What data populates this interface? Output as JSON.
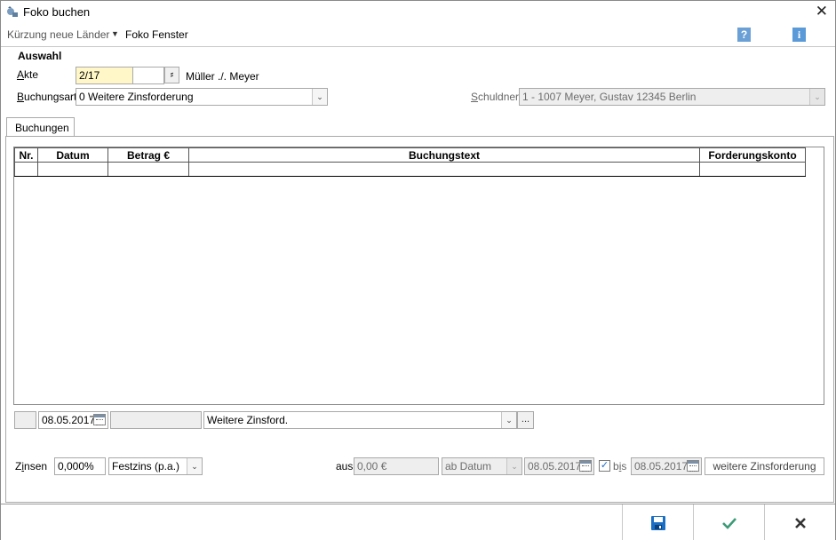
{
  "window": {
    "title": "Foko buchen",
    "close_symbol": "✕"
  },
  "toolbar": {
    "kuerzung_label": "Kürzung neue Länder",
    "foko_label": "Foko Fenster",
    "help_label": "?",
    "info_label": "i"
  },
  "auswahl": {
    "section_title": "Auswahl",
    "akte_label": "Akte",
    "akte_value": "2/17",
    "akte_extra": "",
    "akte_name": "Müller ./. Meyer",
    "buchungsart_label": "Buchungsart",
    "buchungsart_value": "0 Weitere Zinsforderung",
    "schuldner_label": "Schuldner",
    "schuldner_value": "1 - 1007 Meyer, Gustav 12345 Berlin"
  },
  "tabs": [
    {
      "label": "Buchungen"
    }
  ],
  "grid": {
    "columns": [
      "Nr.",
      "Datum",
      "Betrag €",
      "Buchungstext",
      "Forderungskonto"
    ],
    "rows": [
      [
        "",
        "",
        "",
        "",
        ""
      ]
    ]
  },
  "entry": {
    "nr_value": "",
    "date_value": "08.05.2017",
    "betrag_value": "",
    "text_value": "Weitere Zinsford.",
    "ellipsis": "..."
  },
  "zinsen": {
    "label": "Zinsen",
    "rate_value": "0,000%",
    "type_value": "Festzins (p.a.)",
    "aus_label": "aus",
    "aus_value": "0,00 €",
    "ab_value": "ab Datum",
    "from_date": "08.05.2017",
    "bis_label": "bis",
    "bis_checked": true,
    "to_date": "08.05.2017",
    "weitere_button": "weitere Zinsforderung"
  },
  "footer": {
    "save_icon": "save-icon",
    "ok_icon": "checkmark-icon",
    "cancel_icon": "cross-icon"
  },
  "colors": {
    "akte_bg": "#fff7c8",
    "ok_green": "#3c9a78",
    "save_blue": "#1a6fc4"
  }
}
